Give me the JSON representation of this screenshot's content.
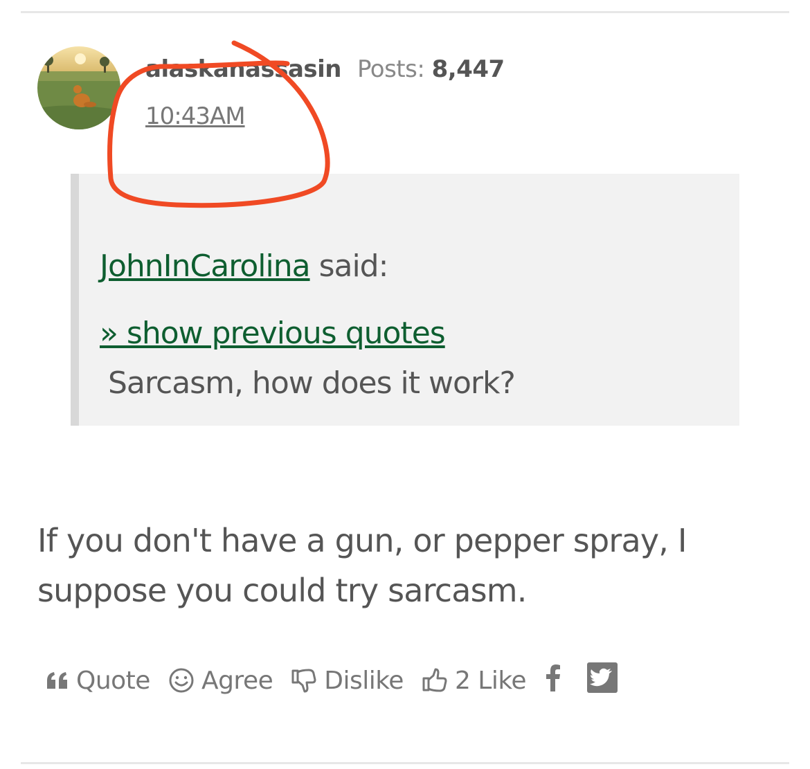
{
  "post": {
    "username": "alaskanassasin",
    "posts_label": "Posts:",
    "posts_count": "8,447",
    "timestamp": "10:43AM"
  },
  "quote": {
    "author": "JohnInCarolina",
    "said": "said:",
    "show_previous": "» show previous quotes",
    "text": "Sarcasm, how does it work?"
  },
  "body": {
    "text": "If you don't have a gun, or pepper spray, I suppose you could try sarcasm."
  },
  "actions": {
    "quote_label": "Quote",
    "agree_label": "Agree",
    "dislike_label": "Dislike",
    "like_label": "2 Like"
  },
  "icons": [
    "quote-icon",
    "smiley-icon",
    "thumbs-down-icon",
    "thumbs-up-icon",
    "facebook-icon",
    "twitter-icon"
  ],
  "colors": {
    "link": "#0e5e30",
    "annotation": "#f04a24",
    "quote_bg": "#f2f2f2"
  }
}
